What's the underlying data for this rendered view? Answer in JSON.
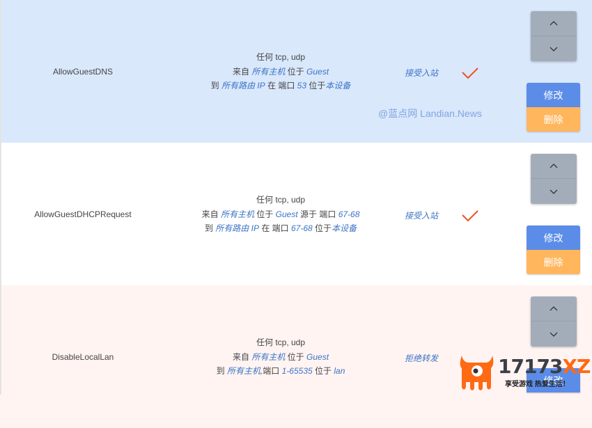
{
  "colors": {
    "row_inbound_bg": "#dae8fc",
    "row_plain_bg": "#ffffff",
    "row_deny_bg": "#fff4f2",
    "link_blue": "#3b73c4",
    "check_orange": "#f0501e",
    "edit_blue": "#5b8de8",
    "delete_orange": "#ffb65c",
    "move_grey": "#a3adba"
  },
  "buttons": {
    "move_up_icon": "chevron-up",
    "move_down_icon": "chevron-down",
    "edit_label": "修改",
    "delete_label": "删除"
  },
  "rules": [
    {
      "name": "AllowGuestDNS",
      "line1": {
        "prefix": "任何",
        "protocols": "tcp, udp"
      },
      "line2": {
        "from": "来自",
        "hosts": "所有主机",
        "at": "位于",
        "zone": "Guest",
        "src_port_label": "",
        "src_port": ""
      },
      "line3": {
        "to": "到",
        "dest": "所有路由 IP",
        "on": "在 端口",
        "port": "53",
        "at": "位于",
        "zone": "本设备"
      },
      "action": "接受入站",
      "enabled": true
    },
    {
      "name": "AllowGuestDHCPRequest",
      "line1": {
        "prefix": "任何",
        "protocols": "tcp, udp"
      },
      "line2": {
        "from": "来自",
        "hosts": "所有主机",
        "at": "位于",
        "zone": "Guest",
        "src_port_label": "源于 端口",
        "src_port": "67-68"
      },
      "line3": {
        "to": "到",
        "dest": "所有路由 IP",
        "on": "在 端口",
        "port": "67-68",
        "at": "位于",
        "zone": "本设备"
      },
      "action": "接受入站",
      "enabled": true
    },
    {
      "name": "DisableLocalLan",
      "line1": {
        "prefix": "任何",
        "protocols": "tcp, udp"
      },
      "line2": {
        "from": "来自",
        "hosts": "所有主机",
        "at": "位于",
        "zone": "Guest",
        "src_port_label": "",
        "src_port": ""
      },
      "line3": {
        "to": "到",
        "dest": "所有主机,",
        "on": "端口",
        "port": "1-65535",
        "at": "位于",
        "zone": "lan"
      },
      "action": "拒绝转发",
      "enabled": false
    }
  ],
  "watermarks": {
    "landian": "@蓝点网 Landian.News",
    "site_num": "17173",
    "site_suffix": "XZ",
    "slogan": "享受游戏 热爱生活！"
  }
}
